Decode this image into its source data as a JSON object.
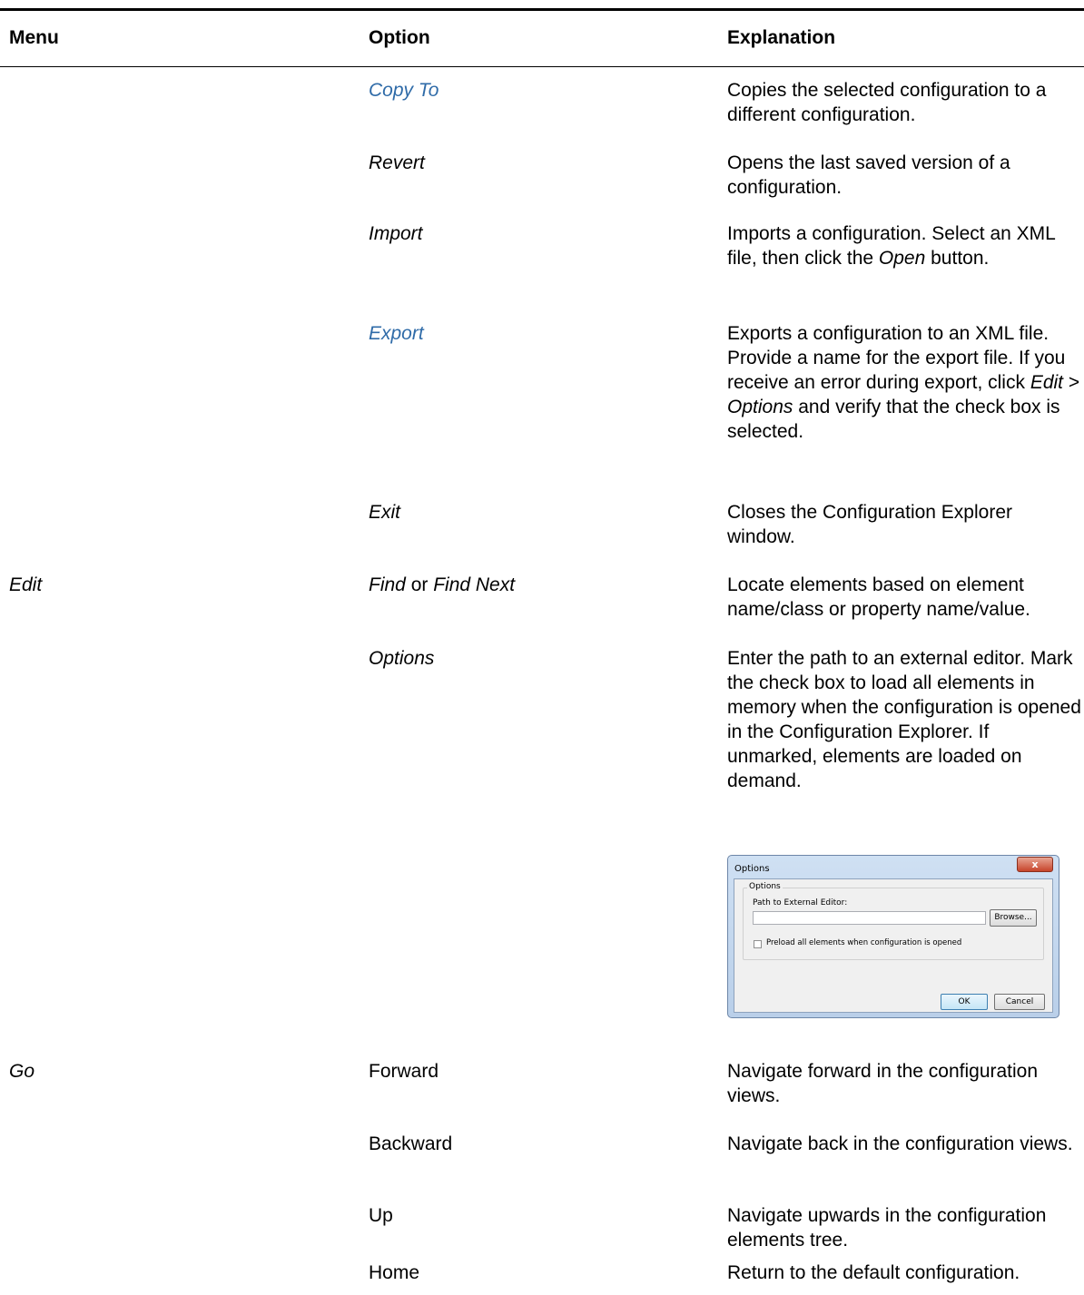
{
  "header": {
    "menu": "Menu",
    "option": "Option",
    "explanation": "Explanation"
  },
  "rows": [
    {
      "menu": "",
      "option": "Copy To",
      "explanation": "Copies the selected configuration to a different configuration."
    },
    {
      "menu": "",
      "option": "Revert",
      "explanation": "Opens the last saved version of a configuration."
    },
    {
      "menu": "",
      "option": "Import",
      "explanation_parts": [
        "Imports a configuration. Select an XML file, then click the ",
        "Open",
        " button."
      ]
    },
    {
      "menu": "",
      "option": "Export",
      "explanation_parts": [
        "Exports a configuration to an XML file. Provide a name for the export file. If you receive an error during export, click ",
        "Edit",
        " > ",
        "Options",
        " and verify that the check box is selected."
      ]
    },
    {
      "menu": "",
      "option": "Exit",
      "explanation": "Closes the Configuration Explorer window."
    },
    {
      "menu": "Edit",
      "option_parts": [
        "Find",
        " or ",
        "Find Next"
      ],
      "explanation": "Locate elements based on element name/class or property name/value."
    },
    {
      "menu": "",
      "option": "Options",
      "explanation": "Enter the path to an external editor. Mark the check box to load all elements in memory when the configuration is opened in the Configuration Explorer. If unmarked, elements are loaded on demand."
    },
    {
      "menu": "Go",
      "option": "Forward",
      "explanation": "Navigate forward in the configuration views."
    },
    {
      "menu": "",
      "option": "Backward",
      "explanation": "Navigate back in the configuration views."
    },
    {
      "menu": "",
      "option": "Up",
      "explanation": "Navigate upwards in the configuration elements tree."
    },
    {
      "menu": "",
      "option": "Home",
      "explanation": "Return to the default configuration."
    }
  ],
  "dialog": {
    "title": "Options",
    "close_label": "x",
    "group_label": "Options",
    "path_label": "Path to External Editor:",
    "path_value": "",
    "browse_label": "Browse...",
    "preload_label": "Preload all elements when configuration is opened",
    "preload_checked": false,
    "ok_label": "OK",
    "cancel_label": "Cancel"
  }
}
